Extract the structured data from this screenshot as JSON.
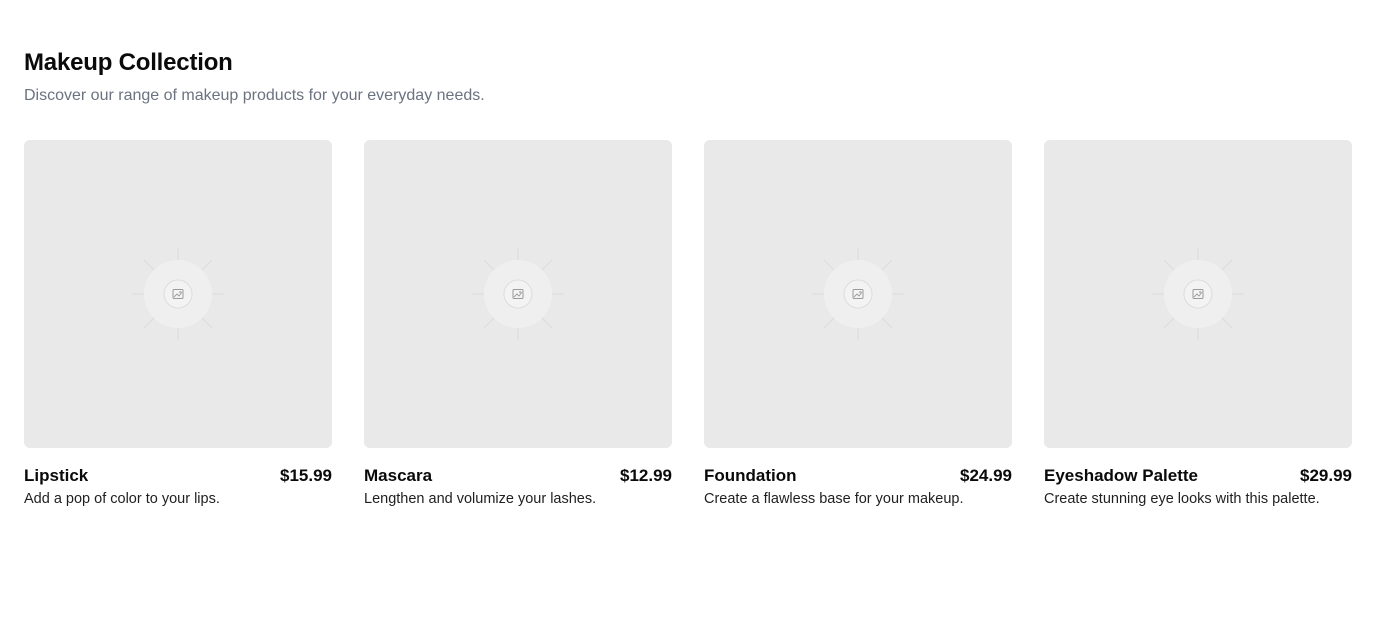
{
  "header": {
    "title": "Makeup Collection",
    "subtitle": "Discover our range of makeup products for your everyday needs."
  },
  "products": [
    {
      "name": "Lipstick",
      "price": "$15.99",
      "description": "Add a pop of color to your lips.",
      "image_icon": "image-placeholder-icon"
    },
    {
      "name": "Mascara",
      "price": "$12.99",
      "description": "Lengthen and volumize your lashes.",
      "image_icon": "image-placeholder-icon"
    },
    {
      "name": "Foundation",
      "price": "$24.99",
      "description": "Create a flawless base for your makeup.",
      "image_icon": "image-placeholder-icon"
    },
    {
      "name": "Eyeshadow Palette",
      "price": "$29.99",
      "description": "Create stunning eye looks with this palette.",
      "image_icon": "image-placeholder-icon"
    }
  ],
  "colors": {
    "placeholder_bg": "#e9e9e9",
    "subtitle": "#6b7280",
    "text": "#0a0a0a"
  }
}
